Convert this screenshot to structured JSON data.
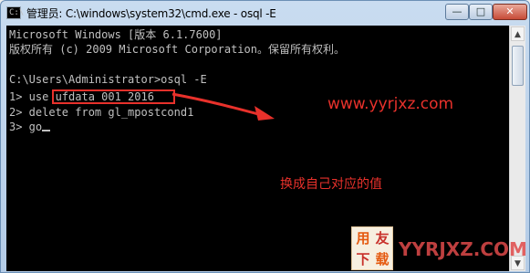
{
  "window": {
    "title": "管理员: C:\\windows\\system32\\cmd.exe - osql  -E",
    "icon_label": "C:\\",
    "controls": {
      "minimize": "—",
      "maximize": "□",
      "close": "✕"
    }
  },
  "console": {
    "lines": [
      "Microsoft Windows [版本 6.1.7600]",
      "版权所有 (c) 2009 Microsoft Corporation。保留所有权利。",
      "",
      "C:\\Users\\Administrator>osql -E",
      "1> use ufdata_001_2016",
      "2> delete from gl_mpostcond1",
      "3> go"
    ]
  },
  "annotations": {
    "url": "www.yyrjxz.com",
    "note": "换成自己对应的值"
  },
  "watermark": {
    "logo_chars": [
      "用",
      "友",
      "下",
      "载"
    ],
    "text": "YYRJXZ.COM"
  },
  "colors": {
    "console_bg": "#000000",
    "console_fg": "#c0c0c0",
    "annotation": "#e8312b"
  },
  "scrollbar": {
    "up": "▲",
    "down": "▼"
  }
}
